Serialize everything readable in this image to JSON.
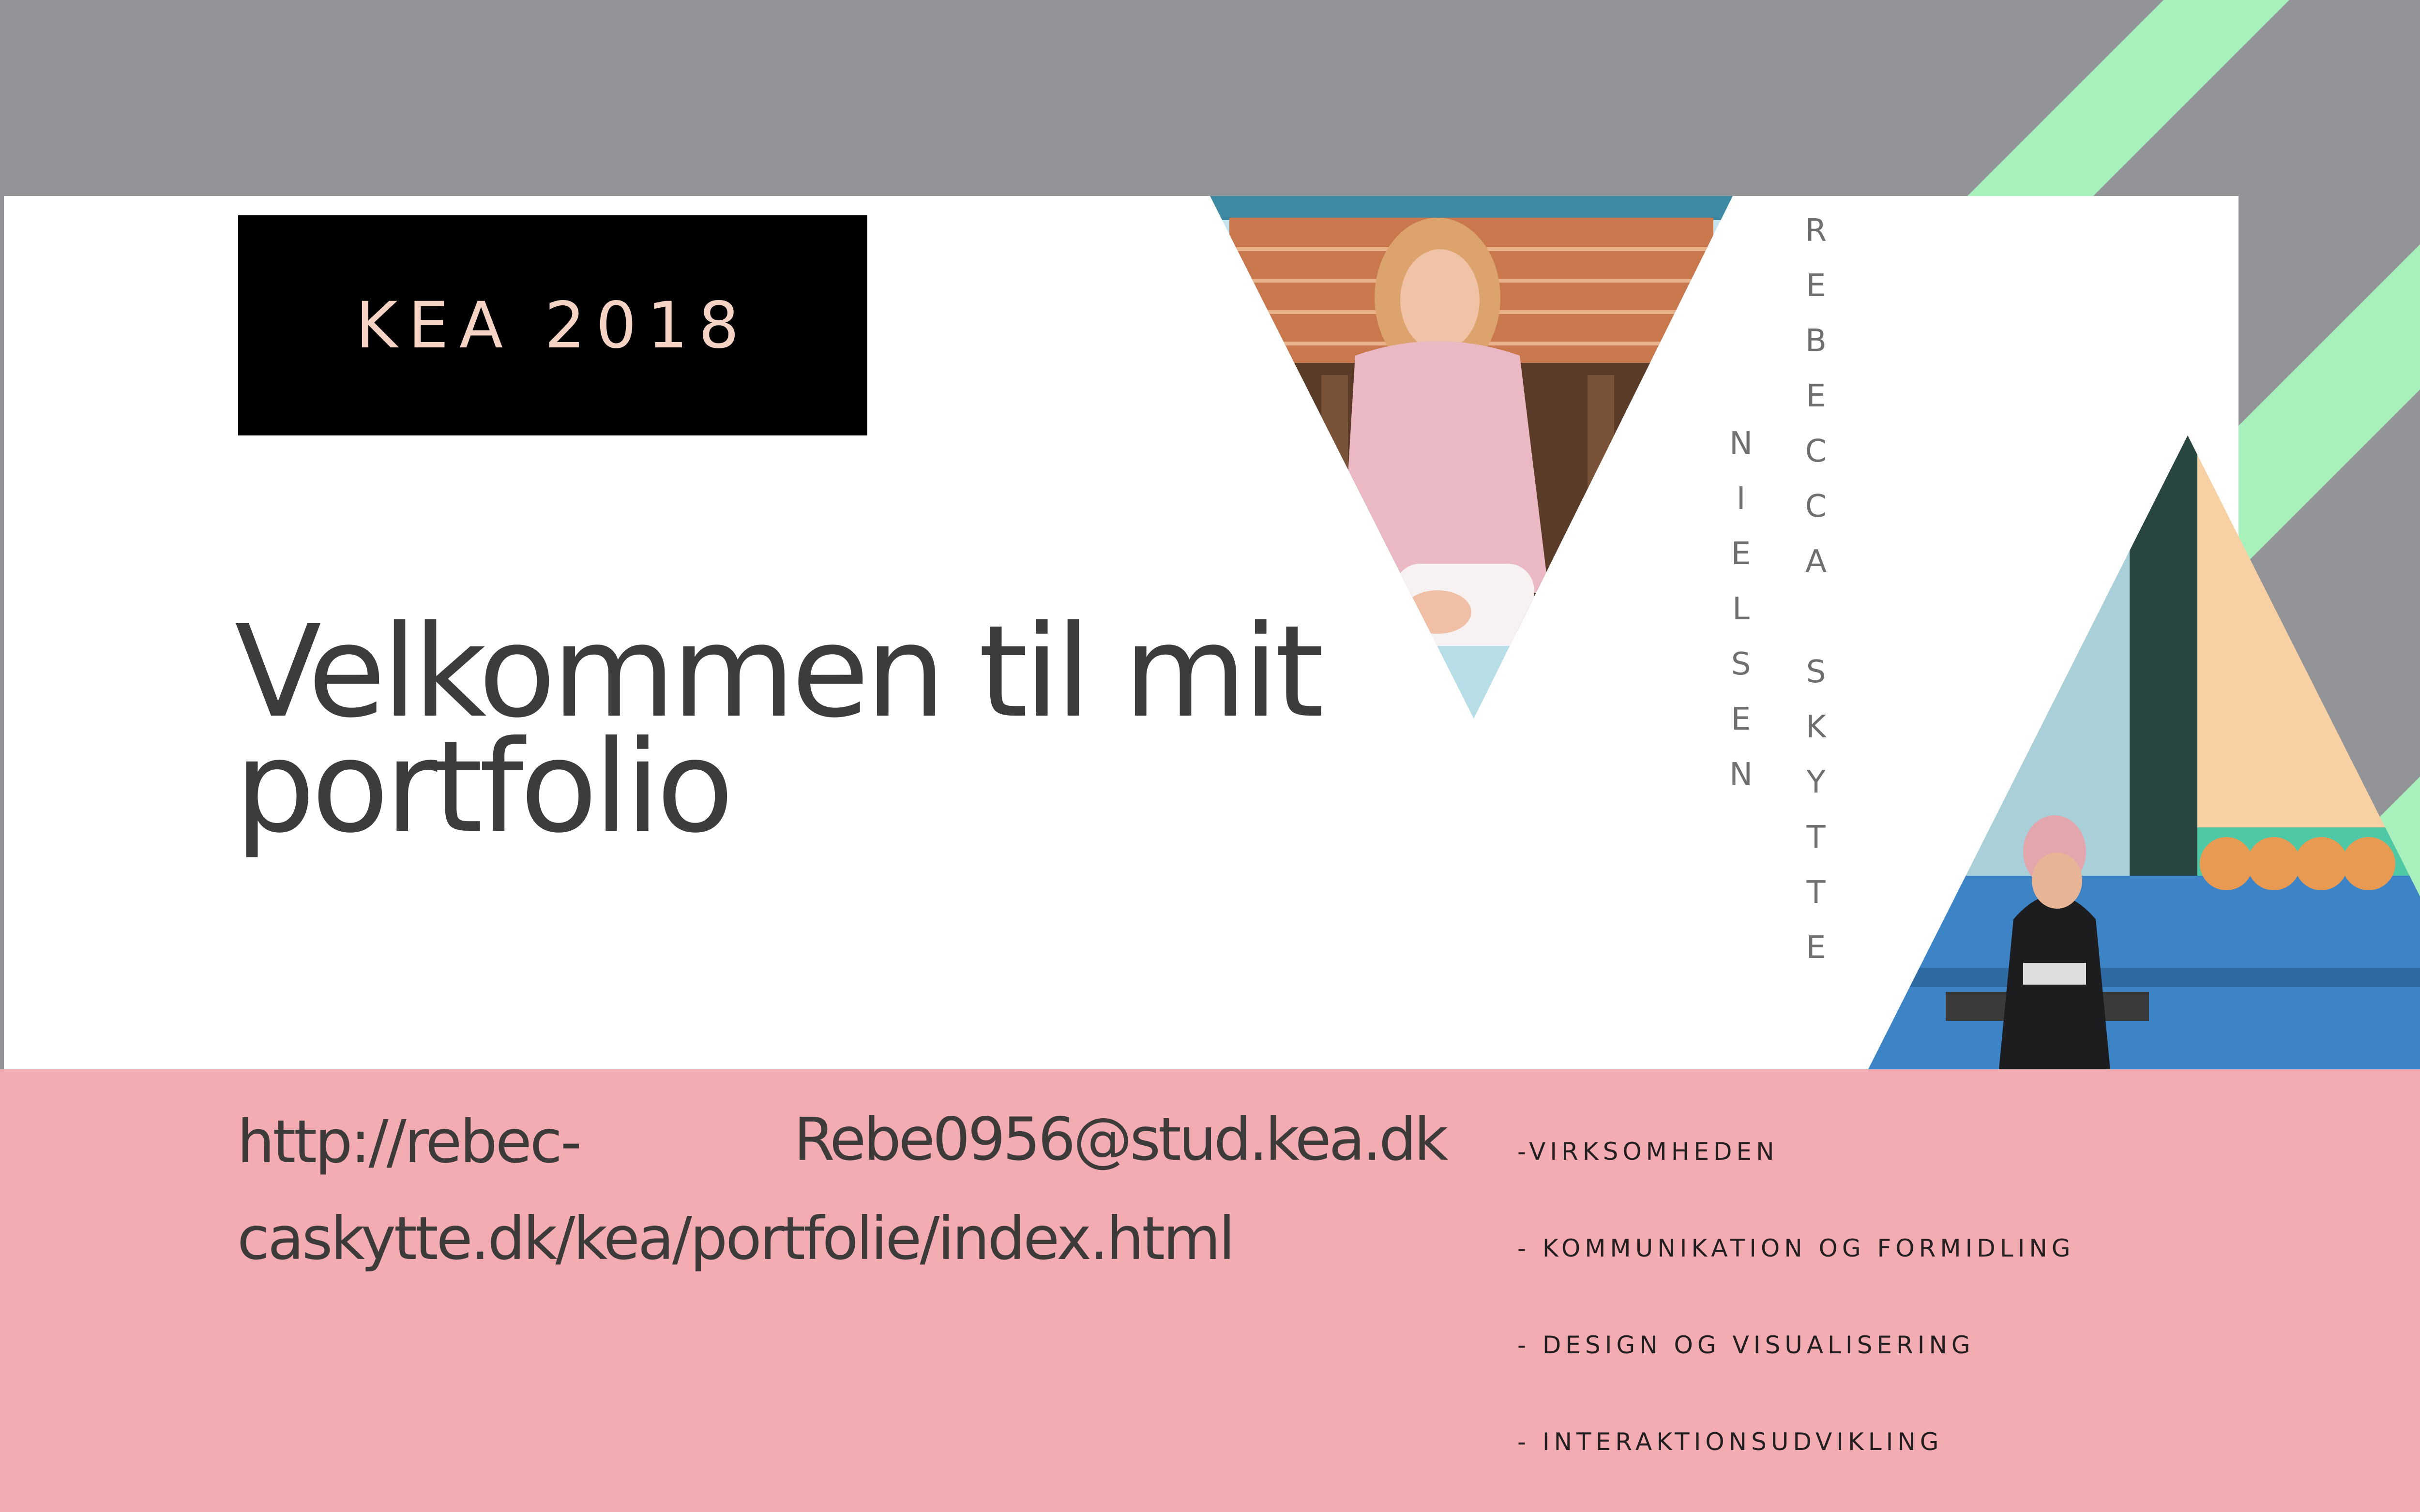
{
  "badge": {
    "text": "KEA 2018"
  },
  "heading": {
    "text": "Velkommen til mit portfolio"
  },
  "name": {
    "first": "REBECCA SKYTTE",
    "last": "NIELSEN"
  },
  "contact": {
    "url": "http://rebec-caskytte.dk/kea/portfolie/index.html",
    "email": "Rebe0956@stud.kea.dk"
  },
  "topics": [
    "-VIRKSOMHEDEN",
    "- KOMMUNIKATION OG FORMIDLING",
    "- DESIGN OG VISUALISERING",
    "- INTERAKTIONSUDVIKLING"
  ],
  "photos": {
    "portrait_icon": "portrait-photo-icon",
    "bench_icon": "bench-photo-icon"
  },
  "colors": {
    "background": "#939497",
    "stripe": "#a8f0bc",
    "panel": "#ffffff",
    "footer": "#f2acb2",
    "badge_bg": "#000000",
    "badge_text": "#f4d3c4",
    "heading": "#3c3c3d"
  }
}
